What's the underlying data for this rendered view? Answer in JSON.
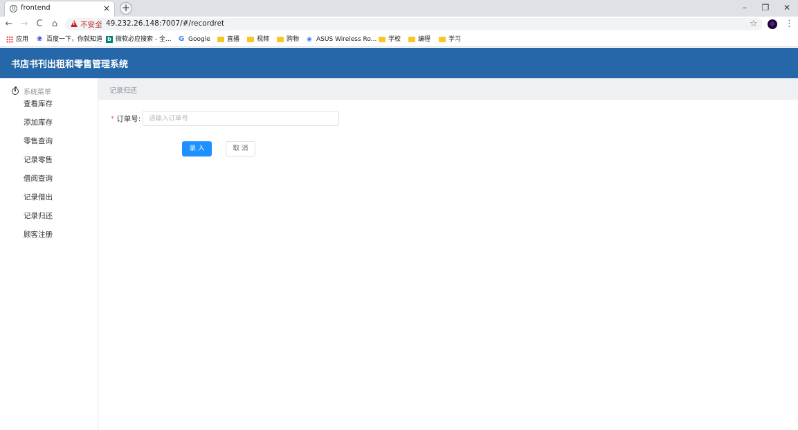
{
  "browser": {
    "tab_title": "frontend",
    "tab_close": "×",
    "new_tab": "+",
    "window": {
      "minimize": "–",
      "restore": "❐",
      "close": "✕"
    },
    "nav": {
      "back": "←",
      "forward": "→",
      "reload": "C",
      "home": "⌂"
    },
    "security_label": "不安全",
    "separator": "|",
    "url": "49.232.26.148:7007/#/recordret",
    "star": "☆",
    "menu": "⋮"
  },
  "bookmarks": [
    {
      "label": "应用",
      "icon": "apps-icon"
    },
    {
      "label": "百度一下，你就知道",
      "icon": "baidu-icon"
    },
    {
      "label": "微软必应搜索 - 全...",
      "icon": "bing-icon"
    },
    {
      "label": "Google",
      "icon": "google-icon"
    },
    {
      "label": "直播",
      "icon": "folder-icon"
    },
    {
      "label": "视频",
      "icon": "folder-icon"
    },
    {
      "label": "购物",
      "icon": "folder-icon"
    },
    {
      "label": "ASUS Wireless Ro...",
      "icon": "wifi-icon"
    },
    {
      "label": "学校",
      "icon": "folder-icon"
    },
    {
      "label": "编程",
      "icon": "folder-icon"
    },
    {
      "label": "学习",
      "icon": "folder-icon"
    }
  ],
  "app": {
    "title": "书店书刊出租和零售管理系统"
  },
  "sidebar": {
    "heading": "系统菜单",
    "items": [
      {
        "label": "查看库存"
      },
      {
        "label": "添加库存"
      },
      {
        "label": "零售查询"
      },
      {
        "label": "记录零售"
      },
      {
        "label": "借阅查询"
      },
      {
        "label": "记录借出"
      },
      {
        "label": "记录归还"
      },
      {
        "label": "顾客注册"
      }
    ]
  },
  "breadcrumb": {
    "current": "记录归还"
  },
  "form": {
    "required_mark": "*",
    "order_label": "订单号:",
    "order_value": "",
    "order_placeholder": "请输入订单号",
    "submit_label": "录 入",
    "cancel_label": "取 消"
  },
  "colors": {
    "header": "#2567a8",
    "primary_button": "#1e90ff",
    "insecure": "#c5221f",
    "required": "#f56c6c"
  }
}
